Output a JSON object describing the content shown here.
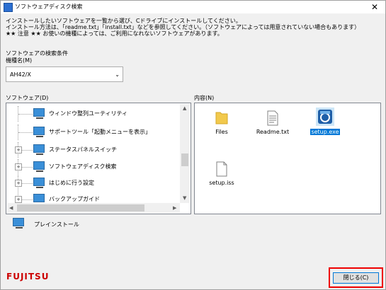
{
  "window": {
    "title": "ソフトウェアディスク検索",
    "close_glyph": "✕"
  },
  "intro": {
    "line1": "インストールしたいソフトウェアを一覧から選び、Cドライブにインストールしてください。",
    "line2": "インストール方法は、「readme.txt」「install.txt」などを参照してください。（ソフトウェアによっては用意されていない場合もあります）",
    "line3": "★★ 注意 ★★ お使いの機種によっては、ご利用になれないソフトウェアがあります。"
  },
  "search": {
    "section_label": "ソフトウェアの検索条件",
    "model_label": "機種名(M)",
    "model_value": "AH42/X",
    "dropdown_glyph": "⌄"
  },
  "software": {
    "label": "ソフトウェア(D)",
    "items": [
      {
        "label": "ウィンドウ整列ユーティリティ",
        "expander": ""
      },
      {
        "label": "サポートツール「起動メニューを表示」",
        "expander": ""
      },
      {
        "label": "ステータスパネルスイッチ",
        "expander": "+"
      },
      {
        "label": "ソフトウェアディスク検索",
        "expander": "+"
      },
      {
        "label": "はじめに行う設定",
        "expander": "+"
      },
      {
        "label": "バックアップガイド",
        "expander": "+"
      }
    ],
    "preinstall_label": "プレインストール"
  },
  "contents": {
    "label": "内容(N)",
    "files": [
      {
        "name": "Files",
        "icon": "folder-icon"
      },
      {
        "name": "Readme.txt",
        "icon": "text-file-icon"
      },
      {
        "name": "setup.exe",
        "icon": "setup-exe-icon"
      },
      {
        "name": "setup.iss",
        "icon": "blank-file-icon"
      }
    ]
  },
  "footer": {
    "logo": "FUJITSU",
    "close_button": "閉じる(C)"
  },
  "colors": {
    "accent": "#0078d7",
    "highlight_border": "#e00000",
    "brand": "#c00000"
  }
}
